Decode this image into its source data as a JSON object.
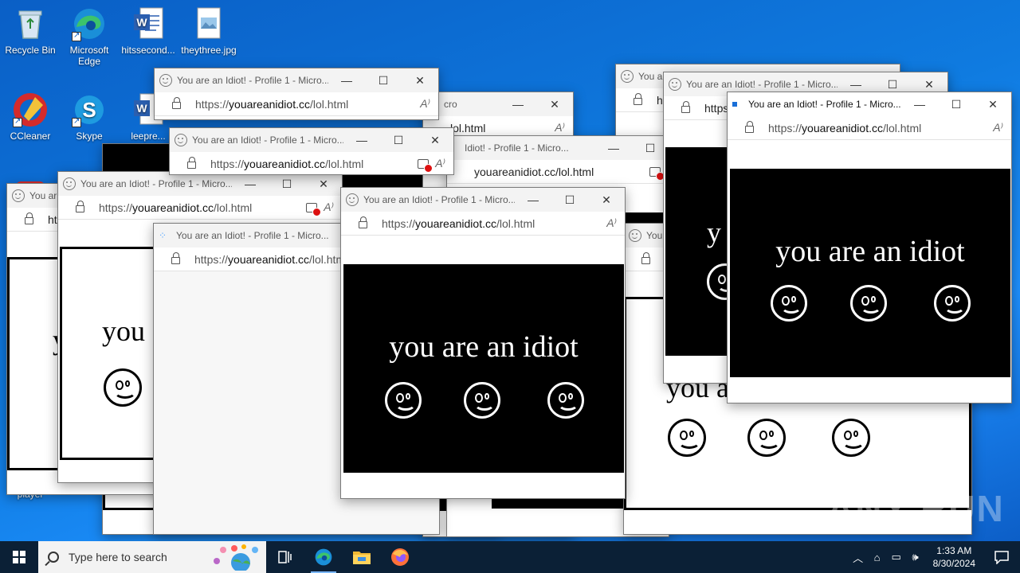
{
  "desktop": {
    "icons": [
      {
        "label": "Recycle Bin"
      },
      {
        "label": "Microsoft Edge"
      },
      {
        "label": "hitssecond..."
      },
      {
        "label": "theythree.jpg"
      },
      {
        "label": "CCleaner"
      },
      {
        "label": "Skype"
      },
      {
        "label": "leepre..."
      },
      {
        "label": "player"
      }
    ]
  },
  "browser": {
    "title": "You are an Idiot! - Profile 1 - Micro...",
    "title_short": "You ar",
    "url_prefix": "https://",
    "url_domain": "youareanidiot.cc",
    "url_path": "/lol.html",
    "url_partial_a": "https",
    "url_partial_b": "ht",
    "url_partial_c": "cro",
    "url_partial_d": "lol.html",
    "url_partial_e": "Idiot! - Profile 1 - Micro...",
    "read_aloud_icon": "read-aloud-icon",
    "controls": {
      "minimize": "—",
      "maximize": "☐",
      "close": "✕"
    }
  },
  "page": {
    "message": "you are an idiot",
    "message_cut": "you",
    "message_cut2": "y",
    "message_cut3": "you a"
  },
  "taskbar": {
    "search_placeholder": "Type here to search",
    "time": "1:33 AM",
    "date": "8/30/2024"
  },
  "watermark": "ANY RUN"
}
